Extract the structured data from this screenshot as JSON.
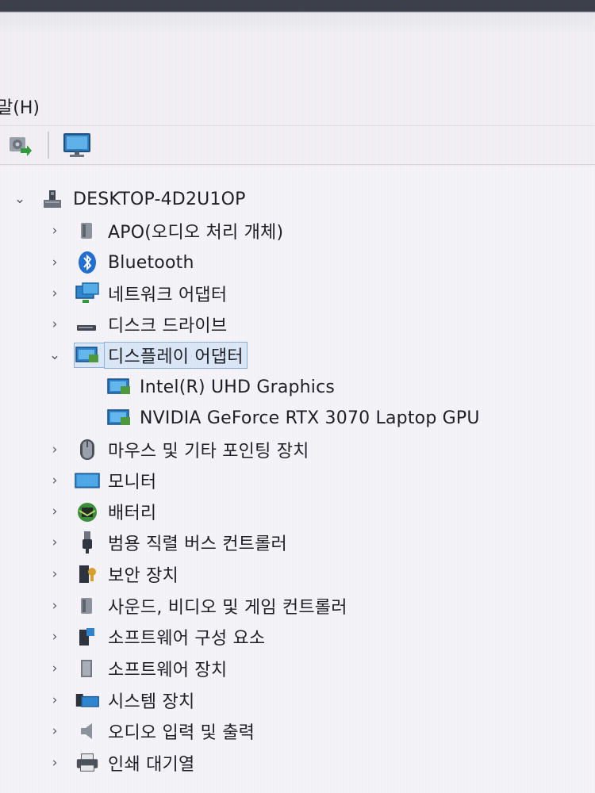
{
  "menu": {
    "help_label": "말(H)"
  },
  "tree": {
    "root": {
      "label": "DESKTOP-4D2U1OP",
      "icon": "computer-icon"
    },
    "categories": [
      {
        "id": "apo",
        "label": "APO(오디오 처리 개체)",
        "icon": "speaker-icon",
        "expanded": false
      },
      {
        "id": "bluetooth",
        "label": "Bluetooth",
        "icon": "bluetooth-icon",
        "expanded": false
      },
      {
        "id": "network",
        "label": "네트워크 어댑터",
        "icon": "network-adapter-icon",
        "expanded": false
      },
      {
        "id": "disk",
        "label": "디스크 드라이브",
        "icon": "disk-drive-icon",
        "expanded": false
      },
      {
        "id": "display",
        "label": "디스플레이 어댑터",
        "icon": "display-adapter-icon",
        "expanded": true,
        "selected": true,
        "children": [
          {
            "label": "Intel(R) UHD Graphics",
            "icon": "display-adapter-icon"
          },
          {
            "label": "NVIDIA GeForce RTX 3070 Laptop GPU",
            "icon": "display-adapter-icon"
          }
        ]
      },
      {
        "id": "mouse",
        "label": "마우스 및 기타 포인팅 장치",
        "icon": "mouse-icon",
        "expanded": false
      },
      {
        "id": "monitor",
        "label": "모니터",
        "icon": "monitor-icon",
        "expanded": false
      },
      {
        "id": "battery",
        "label": "배터리",
        "icon": "battery-icon",
        "expanded": false
      },
      {
        "id": "usb",
        "label": "범용 직렬 버스 컨트롤러",
        "icon": "usb-icon",
        "expanded": false
      },
      {
        "id": "security",
        "label": "보안 장치",
        "icon": "security-device-icon",
        "expanded": false
      },
      {
        "id": "sound",
        "label": "사운드, 비디오 및 게임 컨트롤러",
        "icon": "speaker-icon",
        "expanded": false
      },
      {
        "id": "sw-component",
        "label": "소프트웨어 구성 요소",
        "icon": "software-component-icon",
        "expanded": false
      },
      {
        "id": "sw-device",
        "label": "소프트웨어 장치",
        "icon": "software-device-icon",
        "expanded": false
      },
      {
        "id": "system",
        "label": "시스템 장치",
        "icon": "system-device-icon",
        "expanded": false
      },
      {
        "id": "audio-io",
        "label": "오디오 입력 및 출력",
        "icon": "speaker-icon",
        "expanded": false
      },
      {
        "id": "print-queue",
        "label": "인쇄 대기열",
        "icon": "printer-icon",
        "expanded": false
      }
    ]
  }
}
